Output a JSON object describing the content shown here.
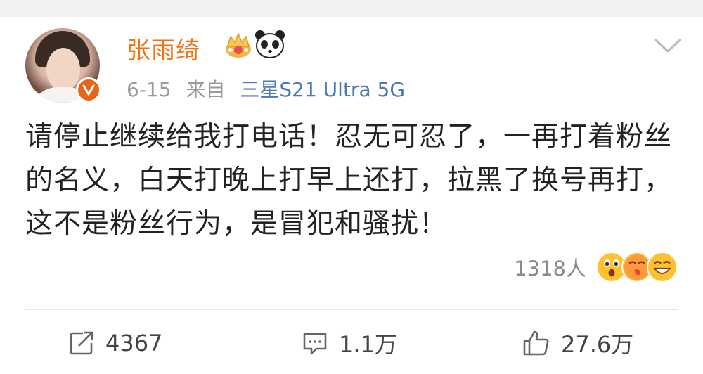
{
  "header": {
    "username": "张雨绮",
    "badges": [
      "crown-icon",
      "panda-icon"
    ],
    "date": "6-15",
    "source_prefix": "来自",
    "source_device": "三星S21 Ultra 5G"
  },
  "post": {
    "text": "请停止继续给我打电话！忍无可忍了，一再打着粉丝的名义，白天打晚上打早上还打，拉黑了换号再打，这不是粉丝行为，是冒犯和骚扰！"
  },
  "reactions": {
    "count": "1318人",
    "emojis": [
      "shocked-emoji-icon",
      "kiss-emoji-icon",
      "grin-emoji-icon"
    ]
  },
  "actions": {
    "repost_count": "4367",
    "comment_count": "1.1万",
    "like_count": "27.6万"
  },
  "colors": {
    "username": "#f57010",
    "source_link": "#4d7ab6",
    "meta": "#9a9a9a",
    "verified_badge": "#e8641b"
  }
}
